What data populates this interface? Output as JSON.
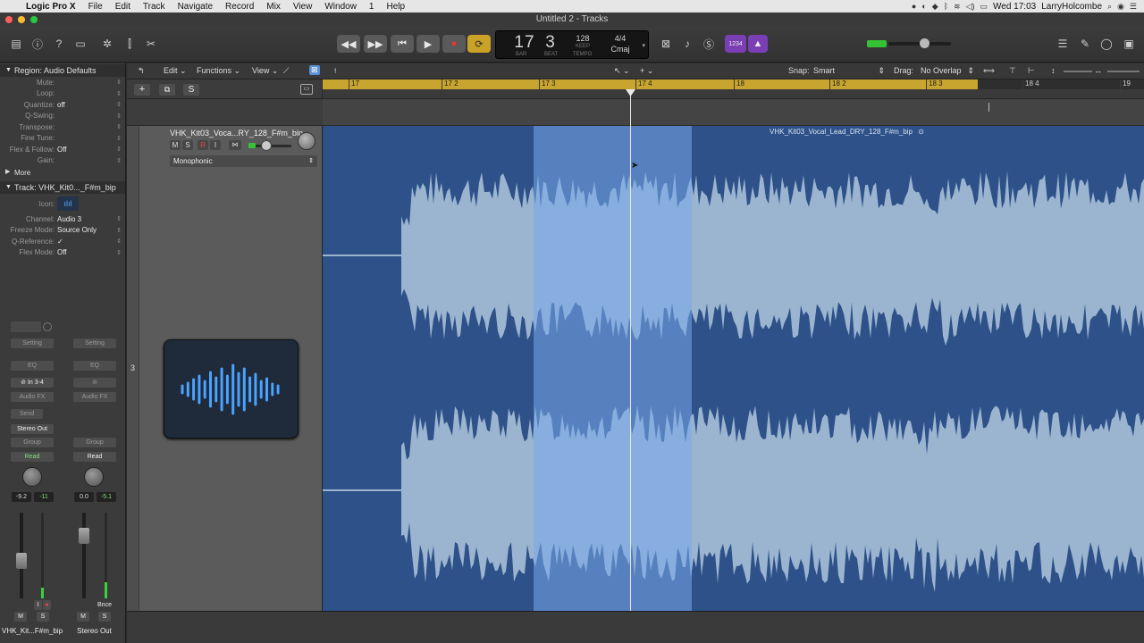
{
  "menubar": {
    "app": "Logic Pro X",
    "items": [
      "File",
      "Edit",
      "Track",
      "Navigate",
      "Record",
      "Mix",
      "View",
      "Window",
      "1",
      "Help"
    ],
    "clock": "Wed 17:03",
    "user": "LarryHolcombe"
  },
  "window": {
    "title": "Untitled 2 - Tracks"
  },
  "lcd": {
    "bar": "17",
    "beat": "3",
    "bar_label": "BAR",
    "beat_label": "BEAT",
    "tempo": "128",
    "tempo_top": "KEEP",
    "tempo_label": "TEMPO",
    "signature": "4/4",
    "key": "Cmaj"
  },
  "toolbar": {
    "badge_1234": "1234"
  },
  "inspector": {
    "region_header": "Region: Audio Defaults",
    "region_rows": [
      {
        "k": "Mute:",
        "v": ""
      },
      {
        "k": "Loop:",
        "v": ""
      },
      {
        "k": "Quantize:",
        "v": "off"
      },
      {
        "k": "Q-Swing:",
        "v": ""
      },
      {
        "k": "Transpose:",
        "v": ""
      },
      {
        "k": "Fine Tune:",
        "v": ""
      },
      {
        "k": "Flex & Follow:",
        "v": "Off"
      },
      {
        "k": "Gain:",
        "v": ""
      }
    ],
    "more": "More",
    "track_header": "Track:  VHK_Kit0..._F#m_bip",
    "track_rows": [
      {
        "k": "Channel:",
        "v": "Audio 3"
      },
      {
        "k": "Freeze Mode:",
        "v": "Source Only"
      },
      {
        "k": "Q-Reference:",
        "v": "✓"
      },
      {
        "k": "Flex Mode:",
        "v": "Off"
      }
    ],
    "icon_label": "Icon:",
    "strip1": {
      "setting": "Setting",
      "eq": "EQ",
      "input": "In 3-4",
      "fx": "Audio FX",
      "send": "Send",
      "output": "Stereo Out",
      "group": "Group",
      "auto": "Read",
      "vol": "-9.2",
      "peak": "-11",
      "m": "M",
      "s": "S",
      "name": "VHK_Kit...F#m_bip"
    },
    "strip2": {
      "setting": "Setting",
      "eq": "EQ",
      "fx": "Audio FX",
      "group": "Group",
      "auto": "Read",
      "vol": "0.0",
      "peak": "-5.1",
      "bnce": "Bnce",
      "m": "M",
      "s": "S",
      "name": "Stereo Out"
    }
  },
  "tracks_toolbar": {
    "edit": "Edit",
    "functions": "Functions",
    "view": "View",
    "snap_label": "Snap:",
    "snap_value": "Smart",
    "drag_label": "Drag:",
    "drag_value": "No Overlap"
  },
  "ruler": {
    "bars": [
      "17",
      "17 2",
      "17 3",
      "17 4",
      "18",
      "18 2",
      "18 3",
      "18 4",
      "19"
    ]
  },
  "track": {
    "number": "3",
    "name": "VHK_Kit03_Voca...RY_128_F#m_bip",
    "m": "M",
    "s": "S",
    "r": "R",
    "i": "I",
    "flex_mode": "Monophonic",
    "header_s": "S"
  },
  "region": {
    "name": "VHK_Kit03_Vocal_Lead_DRY_128_F#m_bip"
  },
  "colors": {
    "region_dark": "#2d5188",
    "wave_light": "#9bb4d0",
    "selection": "#78aaeb",
    "cycle": "#c7a52e"
  }
}
